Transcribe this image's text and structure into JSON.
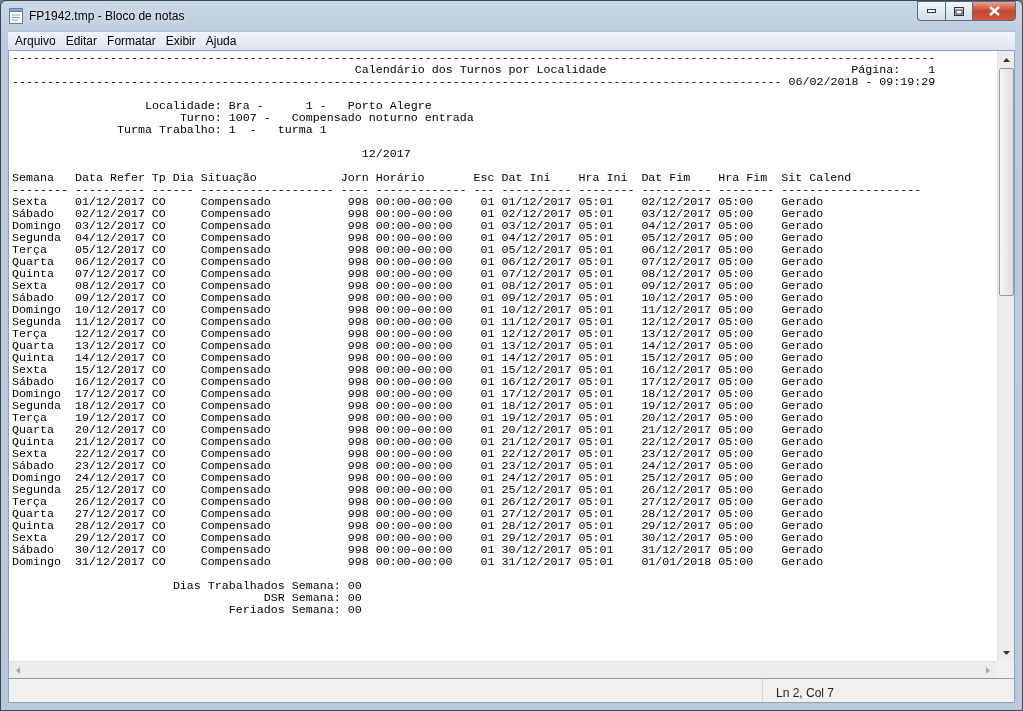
{
  "window": {
    "title": "FP1942.tmp - Bloco de notas"
  },
  "menu": [
    {
      "label": "Arquivo"
    },
    {
      "label": "Editar"
    },
    {
      "label": "Formatar"
    },
    {
      "label": "Exibir"
    },
    {
      "label": "Ajuda"
    }
  ],
  "document": {
    "rule_top": "------------------------------------------------------------------------------------------------------------------------------------",
    "report_title": "Calendário dos Turnos por Localidade",
    "page_label": "Página:",
    "page_number": "1",
    "rule_bottom": "--------------------------------------------------------------------------------------------------------------",
    "timestamp": "06/02/2018 - 09:19:29",
    "info": [
      {
        "label": "Localidade:",
        "parts": [
          "Bra -",
          "1 -",
          "Porto Alegre"
        ]
      },
      {
        "label": "Turno:",
        "parts": [
          "1007 -",
          "Compensado noturno entrada"
        ]
      },
      {
        "label": "Turma Trabalho:",
        "parts": [
          "1  -",
          "turma 1"
        ]
      }
    ],
    "period": "12/2017",
    "table": {
      "columns": [
        "Semana",
        "Data Refer",
        "Tp Dia",
        "Situação",
        "Jorn",
        "Horário",
        "Esc",
        "Dat Ini",
        "Hra Ini",
        "Dat Fim",
        "Hra Fim",
        "Sit Calend"
      ],
      "underlines": [
        "--------",
        "----------",
        "------",
        "-------------------",
        "----",
        "-------------",
        "---",
        "----------",
        "--------",
        "----------",
        "--------",
        "--------------------"
      ],
      "rows": [
        [
          "Sexta",
          "01/12/2017",
          "CO",
          "Compensado",
          "998",
          "00:00-00:00",
          "01",
          "01/12/2017",
          "05:01",
          "02/12/2017",
          "05:00",
          "Gerado"
        ],
        [
          "Sábado",
          "02/12/2017",
          "CO",
          "Compensado",
          "998",
          "00:00-00:00",
          "01",
          "02/12/2017",
          "05:01",
          "03/12/2017",
          "05:00",
          "Gerado"
        ],
        [
          "Domingo",
          "03/12/2017",
          "CO",
          "Compensado",
          "998",
          "00:00-00:00",
          "01",
          "03/12/2017",
          "05:01",
          "04/12/2017",
          "05:00",
          "Gerado"
        ],
        [
          "Segunda",
          "04/12/2017",
          "CO",
          "Compensado",
          "998",
          "00:00-00:00",
          "01",
          "04/12/2017",
          "05:01",
          "05/12/2017",
          "05:00",
          "Gerado"
        ],
        [
          "Terça",
          "05/12/2017",
          "CO",
          "Compensado",
          "998",
          "00:00-00:00",
          "01",
          "05/12/2017",
          "05:01",
          "06/12/2017",
          "05:00",
          "Gerado"
        ],
        [
          "Quarta",
          "06/12/2017",
          "CO",
          "Compensado",
          "998",
          "00:00-00:00",
          "01",
          "06/12/2017",
          "05:01",
          "07/12/2017",
          "05:00",
          "Gerado"
        ],
        [
          "Quinta",
          "07/12/2017",
          "CO",
          "Compensado",
          "998",
          "00:00-00:00",
          "01",
          "07/12/2017",
          "05:01",
          "08/12/2017",
          "05:00",
          "Gerado"
        ],
        [
          "Sexta",
          "08/12/2017",
          "CO",
          "Compensado",
          "998",
          "00:00-00:00",
          "01",
          "08/12/2017",
          "05:01",
          "09/12/2017",
          "05:00",
          "Gerado"
        ],
        [
          "Sábado",
          "09/12/2017",
          "CO",
          "Compensado",
          "998",
          "00:00-00:00",
          "01",
          "09/12/2017",
          "05:01",
          "10/12/2017",
          "05:00",
          "Gerado"
        ],
        [
          "Domingo",
          "10/12/2017",
          "CO",
          "Compensado",
          "998",
          "00:00-00:00",
          "01",
          "10/12/2017",
          "05:01",
          "11/12/2017",
          "05:00",
          "Gerado"
        ],
        [
          "Segunda",
          "11/12/2017",
          "CO",
          "Compensado",
          "998",
          "00:00-00:00",
          "01",
          "11/12/2017",
          "05:01",
          "12/12/2017",
          "05:00",
          "Gerado"
        ],
        [
          "Terça",
          "12/12/2017",
          "CO",
          "Compensado",
          "998",
          "00:00-00:00",
          "01",
          "12/12/2017",
          "05:01",
          "13/12/2017",
          "05:00",
          "Gerado"
        ],
        [
          "Quarta",
          "13/12/2017",
          "CO",
          "Compensado",
          "998",
          "00:00-00:00",
          "01",
          "13/12/2017",
          "05:01",
          "14/12/2017",
          "05:00",
          "Gerado"
        ],
        [
          "Quinta",
          "14/12/2017",
          "CO",
          "Compensado",
          "998",
          "00:00-00:00",
          "01",
          "14/12/2017",
          "05:01",
          "15/12/2017",
          "05:00",
          "Gerado"
        ],
        [
          "Sexta",
          "15/12/2017",
          "CO",
          "Compensado",
          "998",
          "00:00-00:00",
          "01",
          "15/12/2017",
          "05:01",
          "16/12/2017",
          "05:00",
          "Gerado"
        ],
        [
          "Sábado",
          "16/12/2017",
          "CO",
          "Compensado",
          "998",
          "00:00-00:00",
          "01",
          "16/12/2017",
          "05:01",
          "17/12/2017",
          "05:00",
          "Gerado"
        ],
        [
          "Domingo",
          "17/12/2017",
          "CO",
          "Compensado",
          "998",
          "00:00-00:00",
          "01",
          "17/12/2017",
          "05:01",
          "18/12/2017",
          "05:00",
          "Gerado"
        ],
        [
          "Segunda",
          "18/12/2017",
          "CO",
          "Compensado",
          "998",
          "00:00-00:00",
          "01",
          "18/12/2017",
          "05:01",
          "19/12/2017",
          "05:00",
          "Gerado"
        ],
        [
          "Terça",
          "19/12/2017",
          "CO",
          "Compensado",
          "998",
          "00:00-00:00",
          "01",
          "19/12/2017",
          "05:01",
          "20/12/2017",
          "05:00",
          "Gerado"
        ],
        [
          "Quarta",
          "20/12/2017",
          "CO",
          "Compensado",
          "998",
          "00:00-00:00",
          "01",
          "20/12/2017",
          "05:01",
          "21/12/2017",
          "05:00",
          "Gerado"
        ],
        [
          "Quinta",
          "21/12/2017",
          "CO",
          "Compensado",
          "998",
          "00:00-00:00",
          "01",
          "21/12/2017",
          "05:01",
          "22/12/2017",
          "05:00",
          "Gerado"
        ],
        [
          "Sexta",
          "22/12/2017",
          "CO",
          "Compensado",
          "998",
          "00:00-00:00",
          "01",
          "22/12/2017",
          "05:01",
          "23/12/2017",
          "05:00",
          "Gerado"
        ],
        [
          "Sábado",
          "23/12/2017",
          "CO",
          "Compensado",
          "998",
          "00:00-00:00",
          "01",
          "23/12/2017",
          "05:01",
          "24/12/2017",
          "05:00",
          "Gerado"
        ],
        [
          "Domingo",
          "24/12/2017",
          "CO",
          "Compensado",
          "998",
          "00:00-00:00",
          "01",
          "24/12/2017",
          "05:01",
          "25/12/2017",
          "05:00",
          "Gerado"
        ],
        [
          "Segunda",
          "25/12/2017",
          "CO",
          "Compensado",
          "998",
          "00:00-00:00",
          "01",
          "25/12/2017",
          "05:01",
          "26/12/2017",
          "05:00",
          "Gerado"
        ],
        [
          "Terça",
          "26/12/2017",
          "CO",
          "Compensado",
          "998",
          "00:00-00:00",
          "01",
          "26/12/2017",
          "05:01",
          "27/12/2017",
          "05:00",
          "Gerado"
        ],
        [
          "Quarta",
          "27/12/2017",
          "CO",
          "Compensado",
          "998",
          "00:00-00:00",
          "01",
          "27/12/2017",
          "05:01",
          "28/12/2017",
          "05:00",
          "Gerado"
        ],
        [
          "Quinta",
          "28/12/2017",
          "CO",
          "Compensado",
          "998",
          "00:00-00:00",
          "01",
          "28/12/2017",
          "05:01",
          "29/12/2017",
          "05:00",
          "Gerado"
        ],
        [
          "Sexta",
          "29/12/2017",
          "CO",
          "Compensado",
          "998",
          "00:00-00:00",
          "01",
          "29/12/2017",
          "05:01",
          "30/12/2017",
          "05:00",
          "Gerado"
        ],
        [
          "Sábado",
          "30/12/2017",
          "CO",
          "Compensado",
          "998",
          "00:00-00:00",
          "01",
          "30/12/2017",
          "05:01",
          "31/12/2017",
          "05:00",
          "Gerado"
        ],
        [
          "Domingo",
          "31/12/2017",
          "CO",
          "Compensado",
          "998",
          "00:00-00:00",
          "01",
          "31/12/2017",
          "05:01",
          "01/01/2018",
          "05:00",
          "Gerado"
        ]
      ]
    },
    "totals": [
      {
        "label": "Dias Trabalhados Semana:",
        "value": "00"
      },
      {
        "label": "DSR Semana:",
        "value": "00"
      },
      {
        "label": "Feriados Semana:",
        "value": "00"
      }
    ]
  },
  "status_bar": {
    "position": "Ln 2, Col 7"
  }
}
